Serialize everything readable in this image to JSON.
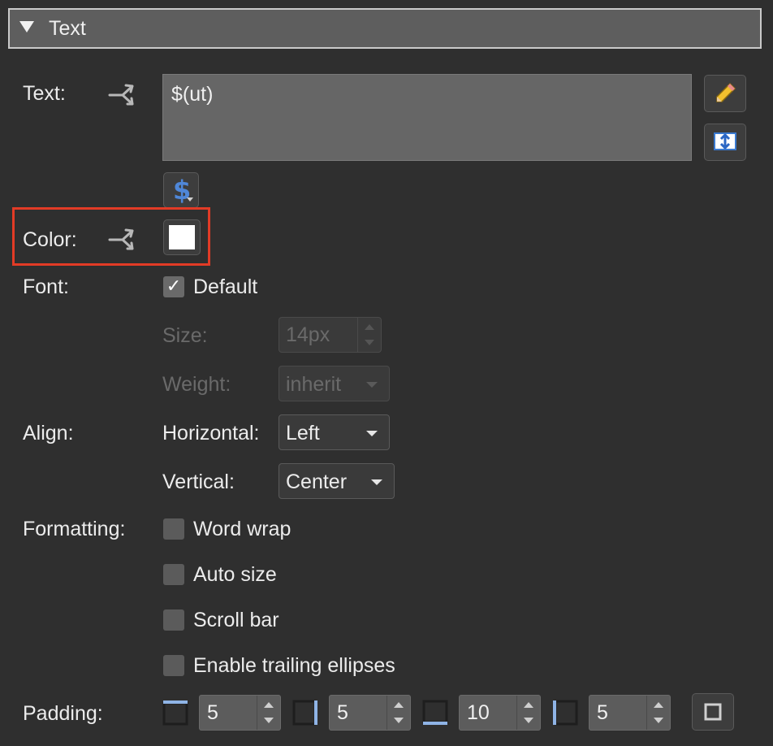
{
  "section": {
    "title": "Text"
  },
  "text_row": {
    "label": "Text:",
    "value": "$(ut)"
  },
  "color_row": {
    "label": "Color:",
    "value": "#ffffff"
  },
  "font_row": {
    "label": "Font:",
    "default_label": "Default",
    "default_checked": true,
    "size_label": "Size:",
    "size_value": "14px",
    "weight_label": "Weight:",
    "weight_value": "inherit"
  },
  "align_row": {
    "label": "Align:",
    "horizontal_label": "Horizontal:",
    "horizontal_value": "Left",
    "vertical_label": "Vertical:",
    "vertical_value": "Center"
  },
  "formatting_row": {
    "label": "Formatting:",
    "options": [
      {
        "label": "Word wrap",
        "checked": false
      },
      {
        "label": "Auto size",
        "checked": false
      },
      {
        "label": "Scroll bar",
        "checked": false
      },
      {
        "label": "Enable trailing ellipses",
        "checked": false
      }
    ]
  },
  "padding_row": {
    "label": "Padding:",
    "top": "5",
    "right": "5",
    "bottom": "10",
    "left": "5"
  },
  "colors": {
    "highlight": "#e23b26",
    "accent_blue": "#4f87d8",
    "pencil_yellow": "#f2c02e"
  },
  "icons": [
    "disclosure-triangle-icon",
    "bind-arrows-icon",
    "pencil-icon",
    "expand-vertical-icon",
    "dollar-icon",
    "padding-top-icon",
    "padding-right-icon",
    "padding-bottom-icon",
    "padding-left-icon",
    "padding-all-icon"
  ]
}
